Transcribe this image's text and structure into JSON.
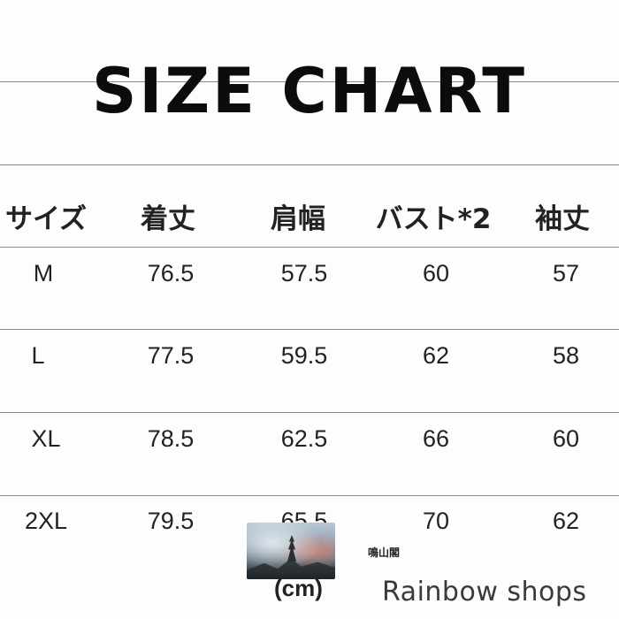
{
  "title": "SIZE CHART",
  "table": {
    "headers": [
      "サイズ",
      "着丈",
      "肩幅",
      "バスト*2",
      "袖丈"
    ],
    "rows": [
      [
        "M",
        "76.5",
        "57.5",
        "60",
        "57"
      ],
      [
        "L",
        "77.5",
        "59.5",
        "62",
        "58"
      ],
      [
        "XL",
        "78.5",
        "62.5",
        "66",
        "60"
      ],
      [
        "2XL",
        "79.5",
        "65.5",
        "70",
        "62"
      ]
    ]
  },
  "overlay": {
    "seal_text": "鳴山閣",
    "unit_text": "(cm)"
  },
  "watermark": "Rainbow shops"
}
